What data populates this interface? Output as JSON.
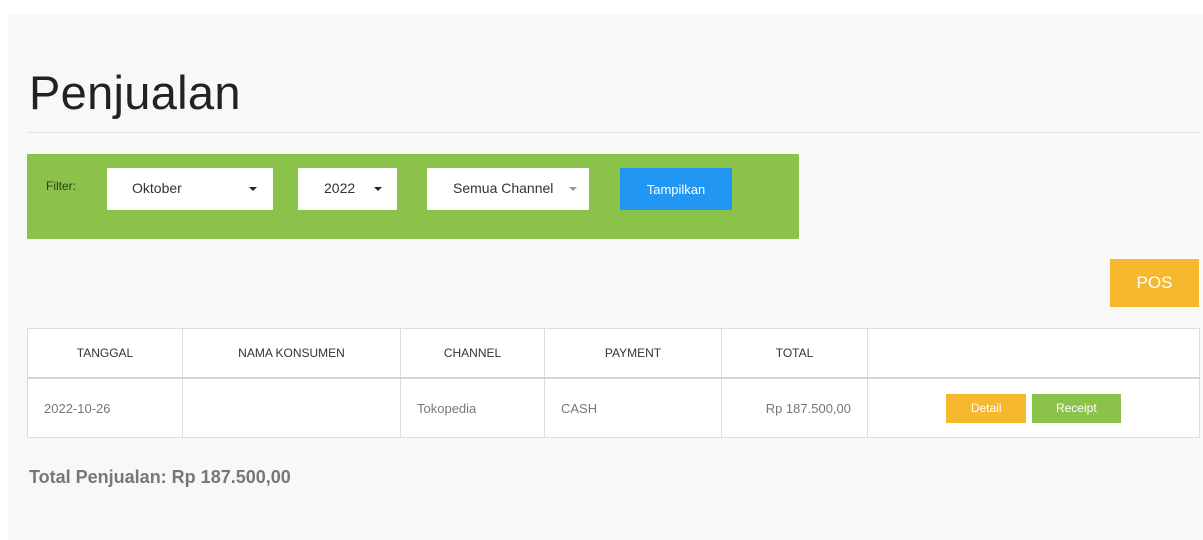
{
  "page": {
    "title": "Penjualan"
  },
  "filter": {
    "label": "Filter:",
    "month": "Oktober",
    "year": "2022",
    "channel": "Semua Channel",
    "submit_label": "Tampilkan"
  },
  "actions": {
    "pos_label": "POS"
  },
  "table": {
    "headers": [
      "TANGGAL",
      "NAMA KONSUMEN",
      "CHANNEL",
      "PAYMENT",
      "TOTAL",
      ""
    ],
    "rows": [
      {
        "tanggal": "2022-10-26",
        "nama_konsumen": "",
        "channel": "Tokopedia",
        "payment": "CASH",
        "total": "Rp 187.500,00",
        "detail_label": "Detail",
        "receipt_label": "Receipt"
      }
    ]
  },
  "summary": {
    "text": "Total Penjualan: Rp 187.500,00"
  },
  "colors": {
    "filter_bar": "#8bc34a",
    "primary_button": "#2196f3",
    "warning_button": "#f5b82e",
    "success_button": "#8bc34a"
  }
}
